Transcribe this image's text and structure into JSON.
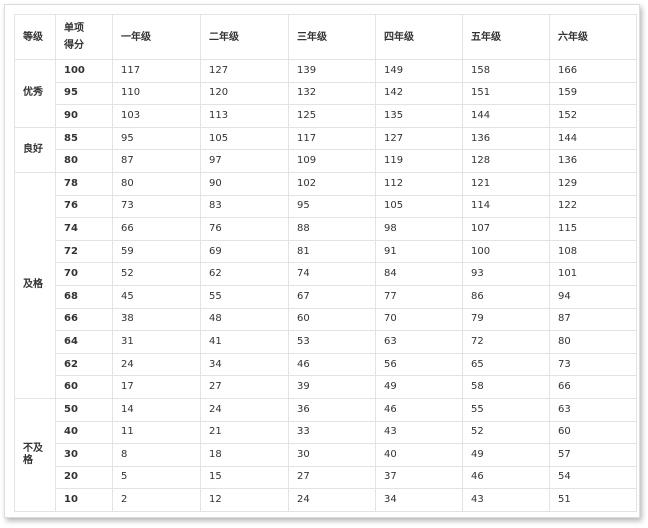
{
  "headers": {
    "level": "等级",
    "score": "单项\n得分",
    "grades": [
      "一年级",
      "二年级",
      "三年级",
      "四年级",
      "五年级",
      "六年级"
    ]
  },
  "groups": [
    {
      "level": "优秀",
      "rows": [
        {
          "score": "100",
          "values": [
            "117",
            "127",
            "139",
            "149",
            "158",
            "166"
          ]
        },
        {
          "score": "95",
          "values": [
            "110",
            "120",
            "132",
            "142",
            "151",
            "159"
          ]
        },
        {
          "score": "90",
          "values": [
            "103",
            "113",
            "125",
            "135",
            "144",
            "152"
          ]
        }
      ]
    },
    {
      "level": "良好",
      "rows": [
        {
          "score": "85",
          "values": [
            "95",
            "105",
            "117",
            "127",
            "136",
            "144"
          ]
        },
        {
          "score": "80",
          "values": [
            "87",
            "97",
            "109",
            "119",
            "128",
            "136"
          ]
        }
      ]
    },
    {
      "level": "及格",
      "rows": [
        {
          "score": "78",
          "values": [
            "80",
            "90",
            "102",
            "112",
            "121",
            "129"
          ]
        },
        {
          "score": "76",
          "values": [
            "73",
            "83",
            "95",
            "105",
            "114",
            "122"
          ]
        },
        {
          "score": "74",
          "values": [
            "66",
            "76",
            "88",
            "98",
            "107",
            "115"
          ]
        },
        {
          "score": "72",
          "values": [
            "59",
            "69",
            "81",
            "91",
            "100",
            "108"
          ]
        },
        {
          "score": "70",
          "values": [
            "52",
            "62",
            "74",
            "84",
            "93",
            "101"
          ]
        },
        {
          "score": "68",
          "values": [
            "45",
            "55",
            "67",
            "77",
            "86",
            "94"
          ]
        },
        {
          "score": "66",
          "values": [
            "38",
            "48",
            "60",
            "70",
            "79",
            "87"
          ]
        },
        {
          "score": "64",
          "values": [
            "31",
            "41",
            "53",
            "63",
            "72",
            "80"
          ]
        },
        {
          "score": "62",
          "values": [
            "24",
            "34",
            "46",
            "56",
            "65",
            "73"
          ]
        },
        {
          "score": "60",
          "values": [
            "17",
            "27",
            "39",
            "49",
            "58",
            "66"
          ]
        }
      ]
    },
    {
      "level": "不及\n格",
      "rows": [
        {
          "score": "50",
          "values": [
            "14",
            "24",
            "36",
            "46",
            "55",
            "63"
          ]
        },
        {
          "score": "40",
          "values": [
            "11",
            "21",
            "33",
            "43",
            "52",
            "60"
          ]
        },
        {
          "score": "30",
          "values": [
            "8",
            "18",
            "30",
            "40",
            "49",
            "57"
          ]
        },
        {
          "score": "20",
          "values": [
            "5",
            "15",
            "27",
            "37",
            "46",
            "54"
          ]
        },
        {
          "score": "10",
          "values": [
            "2",
            "12",
            "24",
            "34",
            "43",
            "51"
          ]
        }
      ]
    }
  ]
}
